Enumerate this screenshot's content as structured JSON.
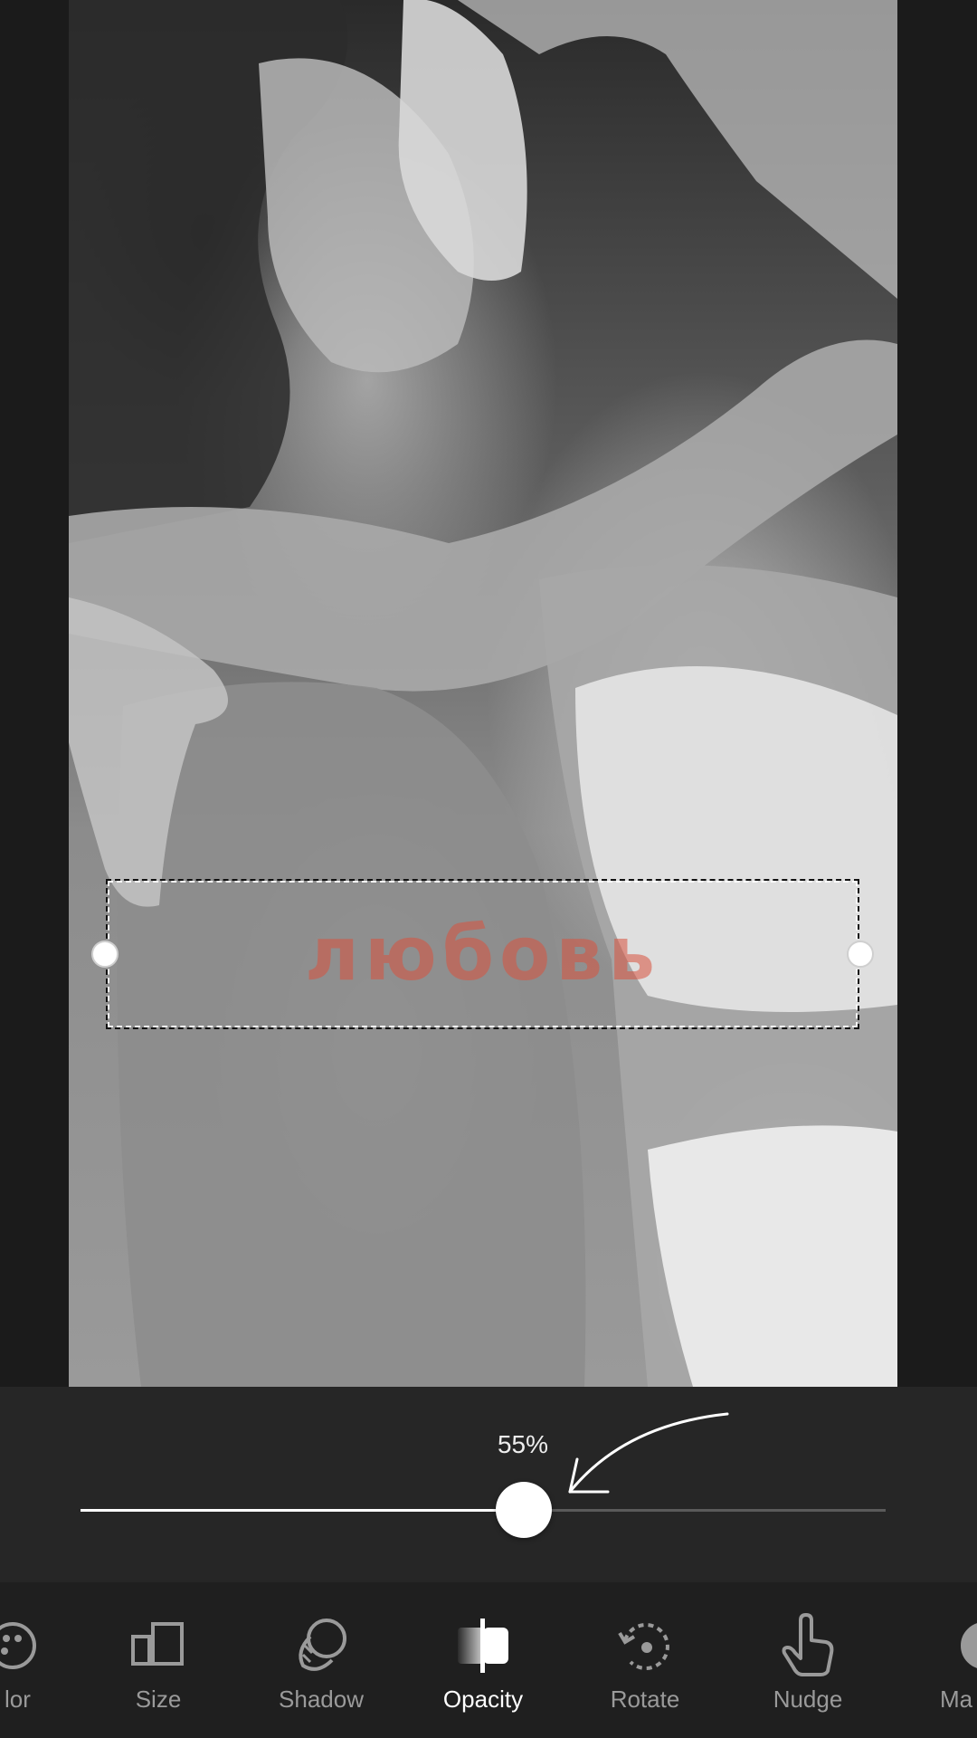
{
  "canvas": {
    "text_layer": {
      "text": "любовь",
      "color": "#d9533f",
      "opacity": 0.55
    }
  },
  "slider": {
    "value_label": "55%",
    "value": 55,
    "min": 0,
    "max": 100
  },
  "toolbar": {
    "tools": [
      {
        "label": "lor",
        "icon": "palette-icon",
        "active": false
      },
      {
        "label": "Size",
        "icon": "size-icon",
        "active": false
      },
      {
        "label": "Shadow",
        "icon": "shadow-icon",
        "active": false
      },
      {
        "label": "Opacity",
        "icon": "opacity-icon",
        "active": true
      },
      {
        "label": "Rotate",
        "icon": "rotate-icon",
        "active": false
      },
      {
        "label": "Nudge",
        "icon": "nudge-hand-icon",
        "active": false
      },
      {
        "label": "Ma",
        "icon": "mask-icon",
        "active": false
      }
    ]
  },
  "colors": {
    "accent": "#ffffff",
    "panel": "#262626",
    "toolbar": "#1f1f1f",
    "inactive_label": "#9a9a9a"
  }
}
